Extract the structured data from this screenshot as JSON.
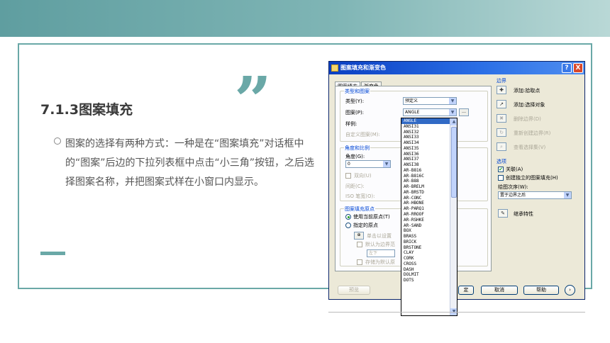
{
  "slide": {
    "title": "7.1.3图案填充",
    "quote_mark": "”",
    "bullet": "图案的选择有两种方式：一种是在“图案填充”对话框中的“图案”后边的下拉列表框中点击“小三角”按钮，之后选择图案名称，并把图案式样在小窗口内显示。"
  },
  "dialog": {
    "title": "图案填充和渐变色",
    "help": "?",
    "close": "X",
    "tabs": [
      "图案填充",
      "渐变色"
    ],
    "left": {
      "group_type": "类型和图案",
      "type_label": "类型(Y):",
      "type_value": "预定义",
      "pattern_label": "图案(P):",
      "pattern_value": "ANGLE",
      "swatch_label": "样例:",
      "custom_label": "自定义图案(M):",
      "group_angle": "角度和比例",
      "angle_label": "角度(G):",
      "angle_value": "0",
      "double_label": "双向(U)",
      "spacing_label": "间距(C):",
      "iso_label": "ISO 笔宽(O):",
      "group_origin": "图案填充原点",
      "use_current": "使用当前原点(T)",
      "specified": "指定的原点",
      "click_set": "单击以设置",
      "default_boundary": "默认为边界范",
      "below": "左下",
      "store_default": "存储为默认原",
      "preview": "预览",
      "ok_partial": "定"
    },
    "dropdown": {
      "items": [
        "ANGLE",
        "ANSI31",
        "ANSI32",
        "ANSI33",
        "ANSI34",
        "ANSI35",
        "ANSI36",
        "ANSI37",
        "ANSI38",
        "AR-B816",
        "AR-B816C",
        "AR-B88",
        "AR-BRELM",
        "AR-BRSTD",
        "AR-CONC",
        "AR-HBONE",
        "AR-PARQ1",
        "AR-RROOF",
        "AR-RSHKE",
        "AR-SAND",
        "BOX",
        "BRASS",
        "BRICK",
        "BRSTONE",
        "CLAY",
        "CORK",
        "CROSS",
        "DASH",
        "DOLMIT",
        "DOTS"
      ]
    },
    "right": {
      "boundary_label": "边界",
      "add_pick": "添加:拾取点",
      "add_select": "添加:选择对象",
      "remove_boundary": "删除边界(D)",
      "recreate_boundary": "重新创建边界(R)",
      "view_selection": "查看选择集(V)",
      "options_label": "选项",
      "associative": "关联(A)",
      "independent": "创建独立的图案填充(H)",
      "draw_order_label": "绘图次序(W):",
      "draw_order_value": "置于边界之后",
      "inherit": "继承特性",
      "cancel": "取消",
      "help": "帮助",
      "expand": "›"
    }
  },
  "colors": {
    "accent": "#6aa8a7",
    "titlebar": "#0a3fc2",
    "selection": "#316ac5"
  }
}
